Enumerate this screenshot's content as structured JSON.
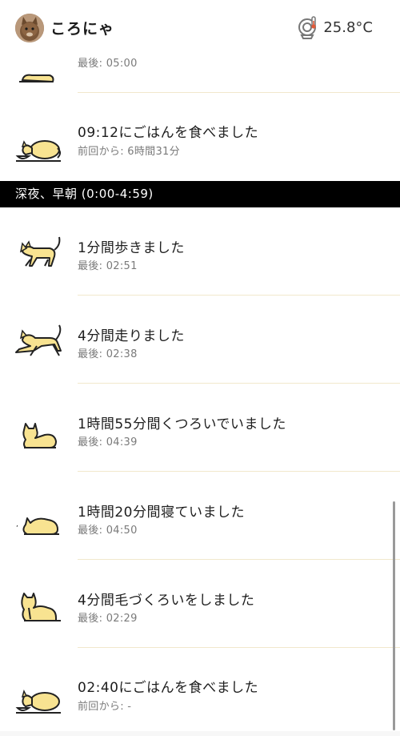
{
  "header": {
    "pet_name": "ころにゃ",
    "temperature": "25.8°C",
    "avatar_icon": "cat-avatar-icon",
    "temp_icon": "toilet-thermometer-icon"
  },
  "top_partial": {
    "subtitle": "最後: 05:00"
  },
  "meal_item": {
    "title": "09:12にごはんを食べました",
    "subtitle": "前回から: 6時間31分"
  },
  "section": {
    "title": "深夜、早朝 (0:00-4:59)"
  },
  "activities": [
    {
      "title": "1分間歩きました",
      "subtitle": "最後: 02:51",
      "icon": "cat-walking-icon"
    },
    {
      "title": "4分間走りました",
      "subtitle": "最後: 02:38",
      "icon": "cat-running-icon"
    },
    {
      "title": "1時間55分間くつろいでいました",
      "subtitle": "最後: 04:39",
      "icon": "cat-relaxing-icon"
    },
    {
      "title": "1時間20分間寝ていました",
      "subtitle": "最後: 04:50",
      "icon": "cat-sleeping-icon"
    },
    {
      "title": "4分間毛づくろいをしました",
      "subtitle": "最後: 02:29",
      "icon": "cat-grooming-icon"
    },
    {
      "title": "02:40にごはんを食べました",
      "subtitle": "前回から: -",
      "icon": "cat-eating-icon"
    }
  ],
  "colors": {
    "cat_fill": "#f8e391",
    "cat_stroke": "#222222",
    "separator": "#f1e8cc",
    "section_bg": "#000000"
  }
}
